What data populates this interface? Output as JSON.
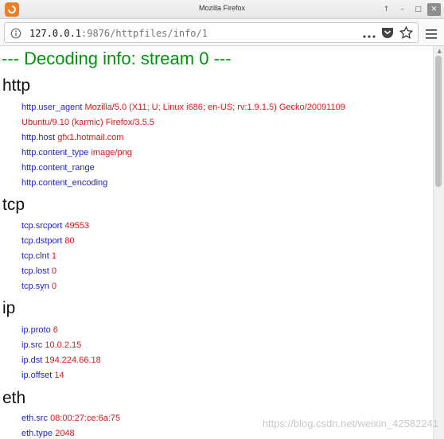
{
  "window": {
    "title": "Mozilla Firefox"
  },
  "browser": {
    "url_host": "127.0.0.1",
    "url_rest": ":9876/httpfiles/info/1"
  },
  "page": {
    "heading": "--- Decoding info: stream 0 ---",
    "sections": [
      {
        "title": "http",
        "fields": [
          {
            "key": "http.user_agent",
            "value": "Mozilla/5.0 (X11; U; Linux i686; en-US; rv:1.9.1.5) Gecko/20091109",
            "value_cont": "Ubuntu/9.10 (karmic) Firefox/3.5.5"
          },
          {
            "key": "http.host",
            "value": "gfx1.hotmail.com"
          },
          {
            "key": "http.content_type",
            "value": "image/png"
          },
          {
            "key": "http.content_range",
            "value": ""
          },
          {
            "key": "http.content_encoding",
            "value": ""
          }
        ]
      },
      {
        "title": "tcp",
        "fields": [
          {
            "key": "tcp.srcport",
            "value": "49553"
          },
          {
            "key": "tcp.dstport",
            "value": "80"
          },
          {
            "key": "tcp.clnt",
            "value": "1"
          },
          {
            "key": "tcp.lost",
            "value": "0"
          },
          {
            "key": "tcp.syn",
            "value": "0"
          }
        ]
      },
      {
        "title": "ip",
        "fields": [
          {
            "key": "ip.proto",
            "value": "6"
          },
          {
            "key": "ip.src",
            "value": "10.0.2.15"
          },
          {
            "key": "ip.dst",
            "value": "194.224.66.18"
          },
          {
            "key": "ip.offset",
            "value": "14"
          }
        ]
      },
      {
        "title": "eth",
        "fields": [
          {
            "key": "eth.src",
            "value": "08:00:27:ce:6a:75"
          },
          {
            "key": "eth.type",
            "value": "2048"
          }
        ]
      }
    ]
  },
  "watermark": "https://blog.csdn.net/weixin_42582241",
  "colors": {
    "heading": "#00940a",
    "key": "#1f1fd9",
    "value": "#e3151b"
  }
}
